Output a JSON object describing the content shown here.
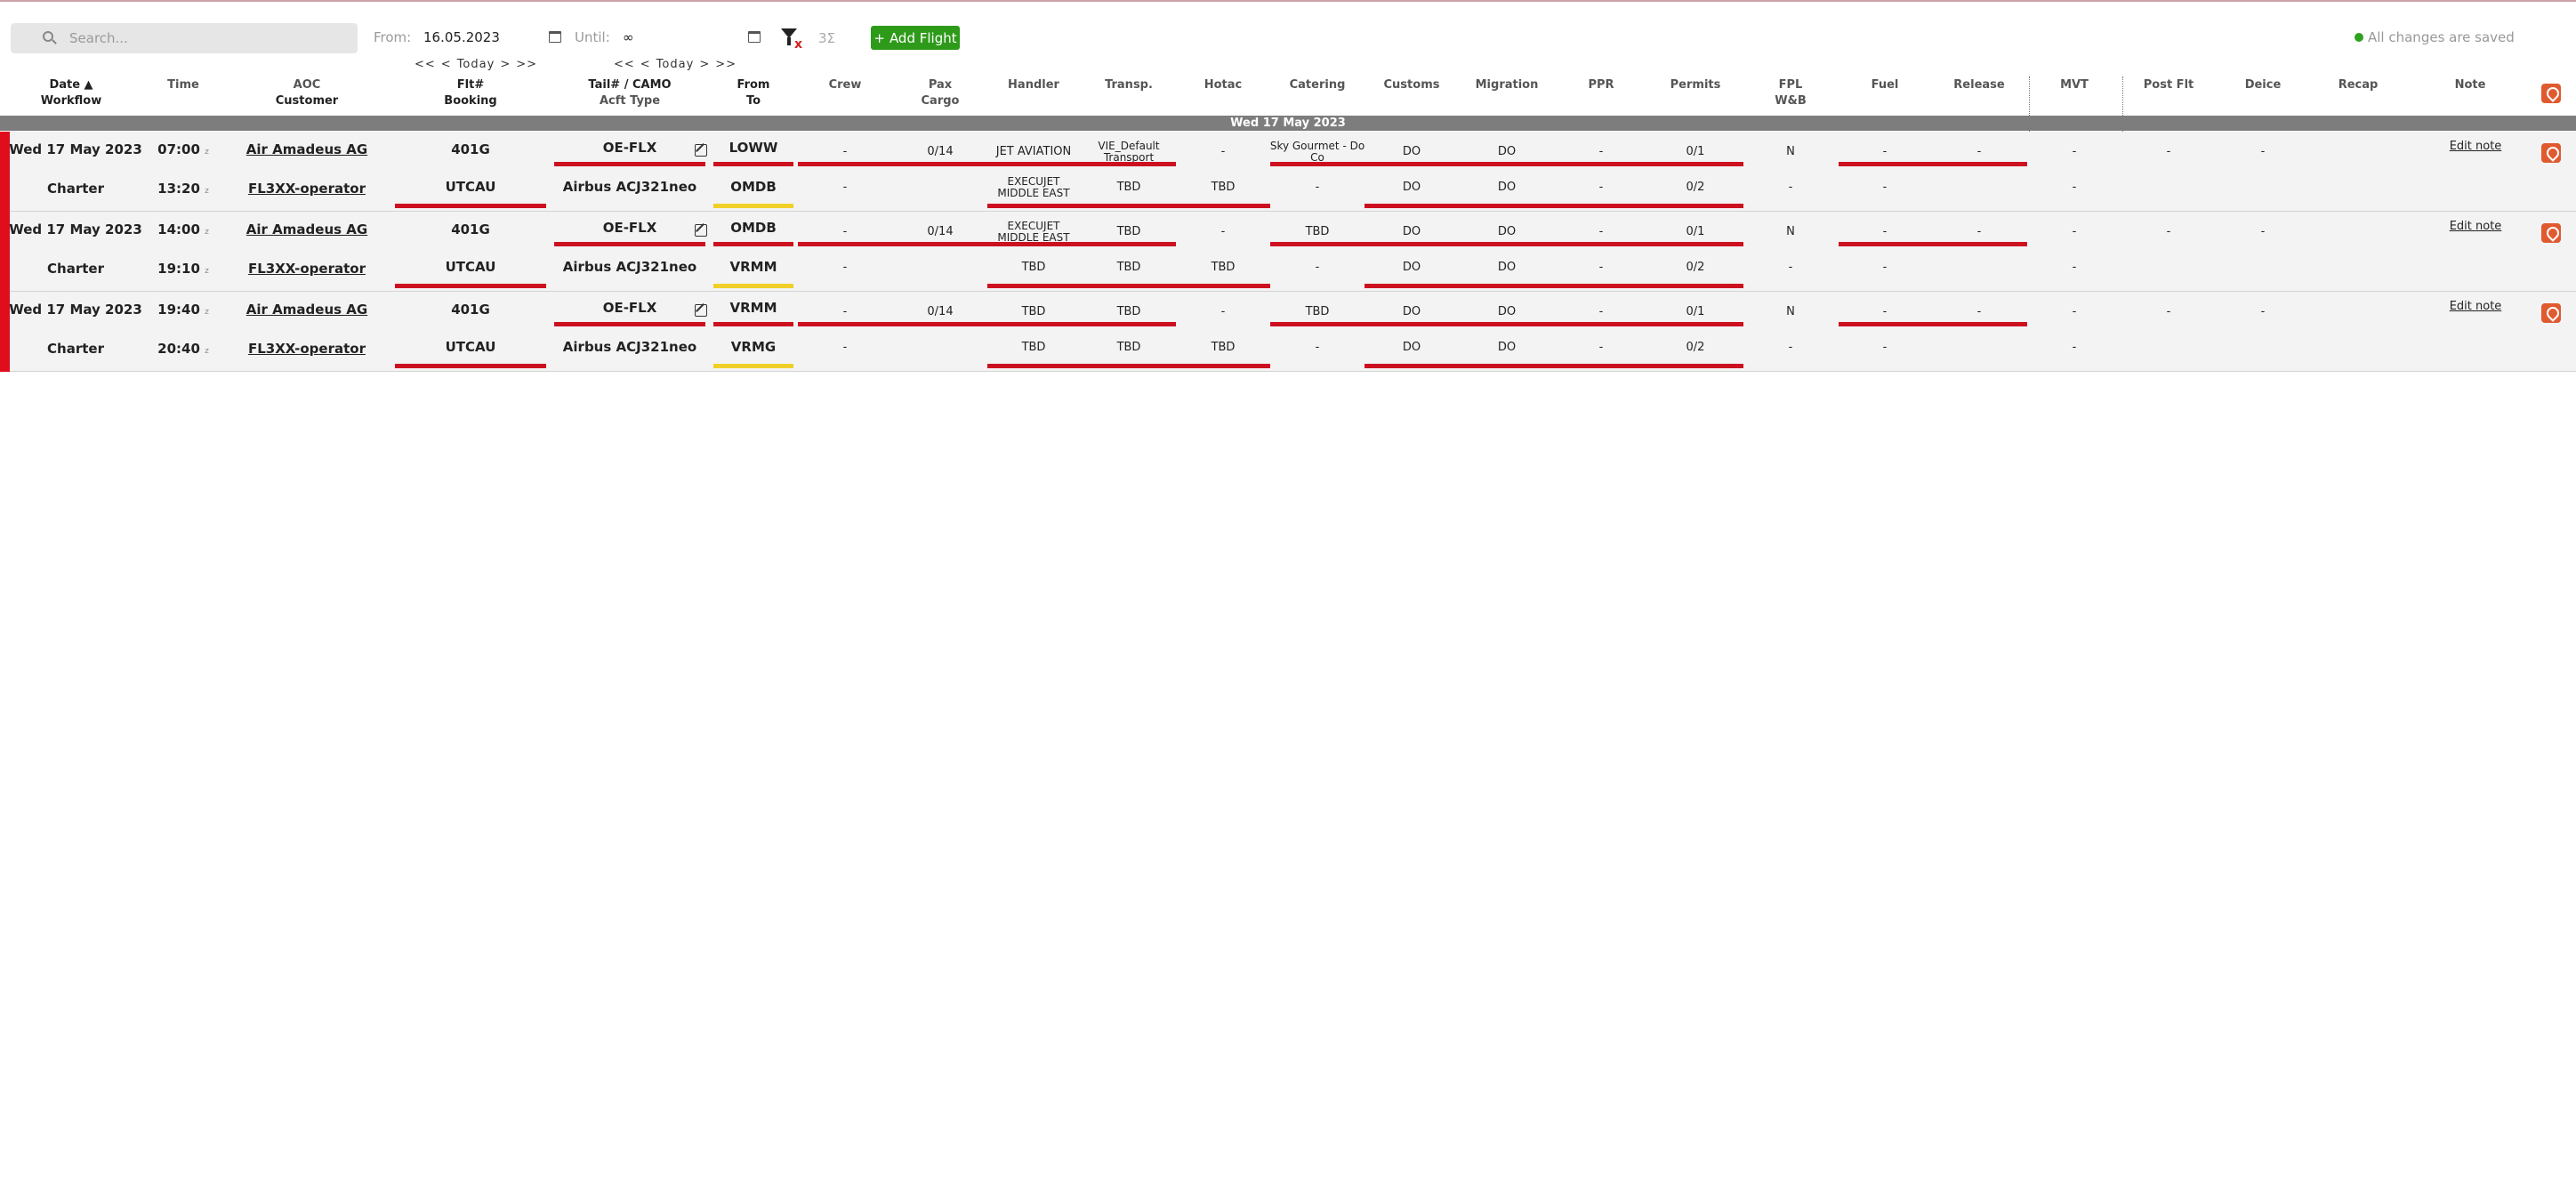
{
  "toolbar": {
    "search_placeholder": "Search...",
    "from_label": "From:",
    "from_value": "16.05.2023",
    "until_label": "Until:",
    "until_value": "∞",
    "nav": [
      "<<",
      "<",
      "Today",
      ">",
      ">>"
    ],
    "sigma": "3Σ",
    "filter_x": "x",
    "add_flight_label": "Add Flight",
    "save_status": "All changes are saved"
  },
  "colors": {
    "accent_green": "#2e9a1a",
    "status_red": "#e00d1c",
    "warn_yellow": "#f0d028",
    "pin_orange": "#e05a30"
  },
  "headers": {
    "date": "Date ▲",
    "workflow": "Workflow",
    "time": "Time",
    "aoc": "AOC",
    "customer": "Customer",
    "flt": "Flt#",
    "booking": "Booking",
    "tail": "Tail# / CAMO",
    "acft": "Acft Type",
    "from": "From",
    "to": "To",
    "crew": "Crew",
    "pax": "Pax",
    "cargo": "Cargo",
    "handler": "Handler",
    "transp": "Transp.",
    "hotac": "Hotac",
    "catering": "Catering",
    "customs": "Customs",
    "migration": "Migration",
    "ppr": "PPR",
    "permits": "Permits",
    "fpl": "FPL",
    "wb": "W&B",
    "fuel": "Fuel",
    "release": "Release",
    "mvt": "MVT",
    "postflt": "Post Flt",
    "deice": "Deice",
    "recap": "Recap",
    "note": "Note"
  },
  "day_label": "Wed 17 May 2023",
  "flights": [
    {
      "date": "Wed 17 May 2023",
      "workflow": "Charter",
      "dep_time": "07:00",
      "arr_time": "13:20",
      "tz": "z",
      "aoc": "Air Amadeus AG",
      "customer": "FL3XX-operator",
      "flt": "401G",
      "booking": "UTCAU",
      "tail": "OE-FLX",
      "acft": "Airbus ACJ321neo",
      "from": "LOWW",
      "to": "OMDB",
      "top": {
        "crew": "-",
        "pax": "0/14",
        "handler": "JET AVIATION",
        "transp1": "VIE_Default",
        "transp2": "Transport",
        "hotac": "-",
        "catering1": "Sky Gourmet - Do",
        "catering2": "Co",
        "customs": "DO",
        "migration": "DO",
        "ppr": "-",
        "permits": "0/1",
        "fpl": "N",
        "fuel": "-",
        "release": "-",
        "mvt": "-",
        "postflt": "-",
        "deice": "-"
      },
      "bot": {
        "crew": "-",
        "handler1": "EXECUJET",
        "handler2": "MIDDLE EAST",
        "transp": "TBD",
        "hotac": "TBD",
        "catering": "-",
        "customs": "DO",
        "migration": "DO",
        "ppr": "-",
        "permits": "0/2",
        "wb": "-",
        "fuel": "-",
        "mvt": "-"
      },
      "note": "Edit note"
    },
    {
      "date": "Wed 17 May 2023",
      "workflow": "Charter",
      "dep_time": "14:00",
      "arr_time": "19:10",
      "tz": "z",
      "aoc": "Air Amadeus AG",
      "customer": "FL3XX-operator",
      "flt": "401G",
      "booking": "UTCAU",
      "tail": "OE-FLX",
      "acft": "Airbus ACJ321neo",
      "from": "OMDB",
      "to": "VRMM",
      "top": {
        "crew": "-",
        "pax": "0/14",
        "handler1": "EXECUJET",
        "handler2": "MIDDLE EAST",
        "transp": "TBD",
        "hotac": "-",
        "catering": "TBD",
        "customs": "DO",
        "migration": "DO",
        "ppr": "-",
        "permits": "0/1",
        "fpl": "N",
        "fuel": "-",
        "release": "-",
        "mvt": "-",
        "postflt": "-",
        "deice": "-"
      },
      "bot": {
        "crew": "-",
        "handler": "TBD",
        "transp": "TBD",
        "hotac": "TBD",
        "catering": "-",
        "customs": "DO",
        "migration": "DO",
        "ppr": "-",
        "permits": "0/2",
        "wb": "-",
        "fuel": "-",
        "mvt": "-"
      },
      "note": "Edit note"
    },
    {
      "date": "Wed 17 May 2023",
      "workflow": "Charter",
      "dep_time": "19:40",
      "arr_time": "20:40",
      "tz": "z",
      "aoc": "Air Amadeus AG",
      "customer": "FL3XX-operator",
      "flt": "401G",
      "booking": "UTCAU",
      "tail": "OE-FLX",
      "acft": "Airbus ACJ321neo",
      "from": "VRMM",
      "to": "VRMG",
      "top": {
        "crew": "-",
        "pax": "0/14",
        "handler": "TBD",
        "transp": "TBD",
        "hotac": "-",
        "catering": "TBD",
        "customs": "DO",
        "migration": "DO",
        "ppr": "-",
        "permits": "0/1",
        "fpl": "N",
        "fuel": "-",
        "release": "-",
        "mvt": "-",
        "postflt": "-",
        "deice": "-"
      },
      "bot": {
        "crew": "-",
        "handler": "TBD",
        "transp": "TBD",
        "hotac": "TBD",
        "catering": "-",
        "customs": "DO",
        "migration": "DO",
        "ppr": "-",
        "permits": "0/2",
        "wb": "-",
        "fuel": "-",
        "mvt": "-"
      },
      "note": "Edit note"
    }
  ]
}
